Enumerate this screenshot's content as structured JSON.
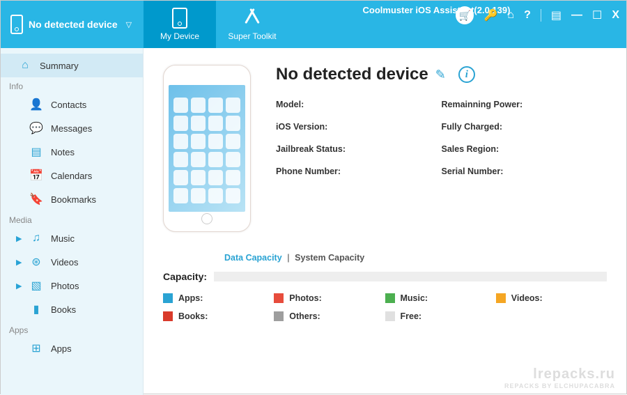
{
  "app_title": "Coolmuster iOS Assistant(2.0.139)",
  "device_selector": {
    "label": "No detected device"
  },
  "tabs": {
    "my_device": "My Device",
    "super_toolkit": "Super Toolkit"
  },
  "sidebar": {
    "summary": "Summary",
    "groups": {
      "info": "Info",
      "media": "Media",
      "apps": "Apps"
    },
    "items": {
      "contacts": "Contacts",
      "messages": "Messages",
      "notes": "Notes",
      "calendars": "Calendars",
      "bookmarks": "Bookmarks",
      "music": "Music",
      "videos": "Videos",
      "photos": "Photos",
      "books": "Books",
      "apps": "Apps"
    }
  },
  "main": {
    "device_name": "No detected device",
    "specs": {
      "model": "Model:",
      "remaining_power": "Remainning Power:",
      "ios_version": "iOS Version:",
      "fully_charged": "Fully Charged:",
      "jailbreak_status": "Jailbreak Status:",
      "sales_region": "Sales Region:",
      "phone_number": "Phone Number:",
      "serial_number": "Serial Number:"
    },
    "capacity_tabs": {
      "data": "Data Capacity",
      "system": "System Capacity"
    },
    "capacity_label": "Capacity:",
    "legend": {
      "apps": {
        "label": "Apps:",
        "color": "#2aa3d3"
      },
      "photos": {
        "label": "Photos:",
        "color": "#e74c3c"
      },
      "music": {
        "label": "Music:",
        "color": "#4caf50"
      },
      "videos": {
        "label": "Videos:",
        "color": "#f5a623"
      },
      "books": {
        "label": "Books:",
        "color": "#d93a2b"
      },
      "others": {
        "label": "Others:",
        "color": "#9e9e9e"
      },
      "free": {
        "label": "Free:",
        "color": "#e0e0e0"
      }
    }
  },
  "watermark": {
    "line1": "lrepacks.ru",
    "line2": "REPACKS BY ELCHUPACABRA"
  }
}
